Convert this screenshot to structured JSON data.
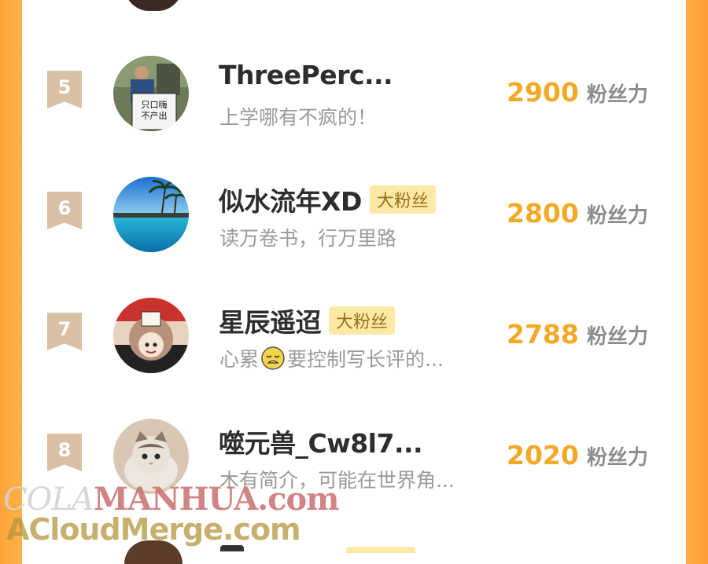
{
  "leaderboard": {
    "score_unit": "粉丝力",
    "rows": [
      {
        "rank": "5",
        "name": "ThreePerc...",
        "badge": "",
        "bio_before": "上学哪有不疯的！",
        "bio_after": "",
        "score": "2900",
        "avatar": "man-with-sign-avatar",
        "avatar_sign": "只口嗨 不产出"
      },
      {
        "rank": "6",
        "name": "似水流年XD",
        "badge": "大粉丝",
        "bio_before": "读万卷书，行万里路",
        "bio_after": "",
        "score": "2800",
        "avatar": "beach-scene-avatar"
      },
      {
        "rank": "7",
        "name": "星辰遥迢",
        "badge": "大粉丝",
        "bio_before": "心累",
        "bio_after": "要控制写长评的...",
        "score": "2788",
        "avatar": "anime-character-avatar",
        "emoji": "tired-face-emoji"
      },
      {
        "rank": "8",
        "name": "噬元兽_Cw8l7...",
        "badge": "",
        "bio_before": "木有简介，可能在世界角...",
        "bio_after": "",
        "score": "2020",
        "avatar": "cat-avatar"
      }
    ]
  },
  "watermark": {
    "line1_a": "COLA",
    "line1_b": "MANHUA.com",
    "line2": "ACloudMerge.com"
  },
  "colors": {
    "accent_orange": "#ffa43a",
    "score_gold": "#f3a826",
    "badge_bg": "#fde9a5",
    "rank_badge": "#d9bfa3"
  }
}
